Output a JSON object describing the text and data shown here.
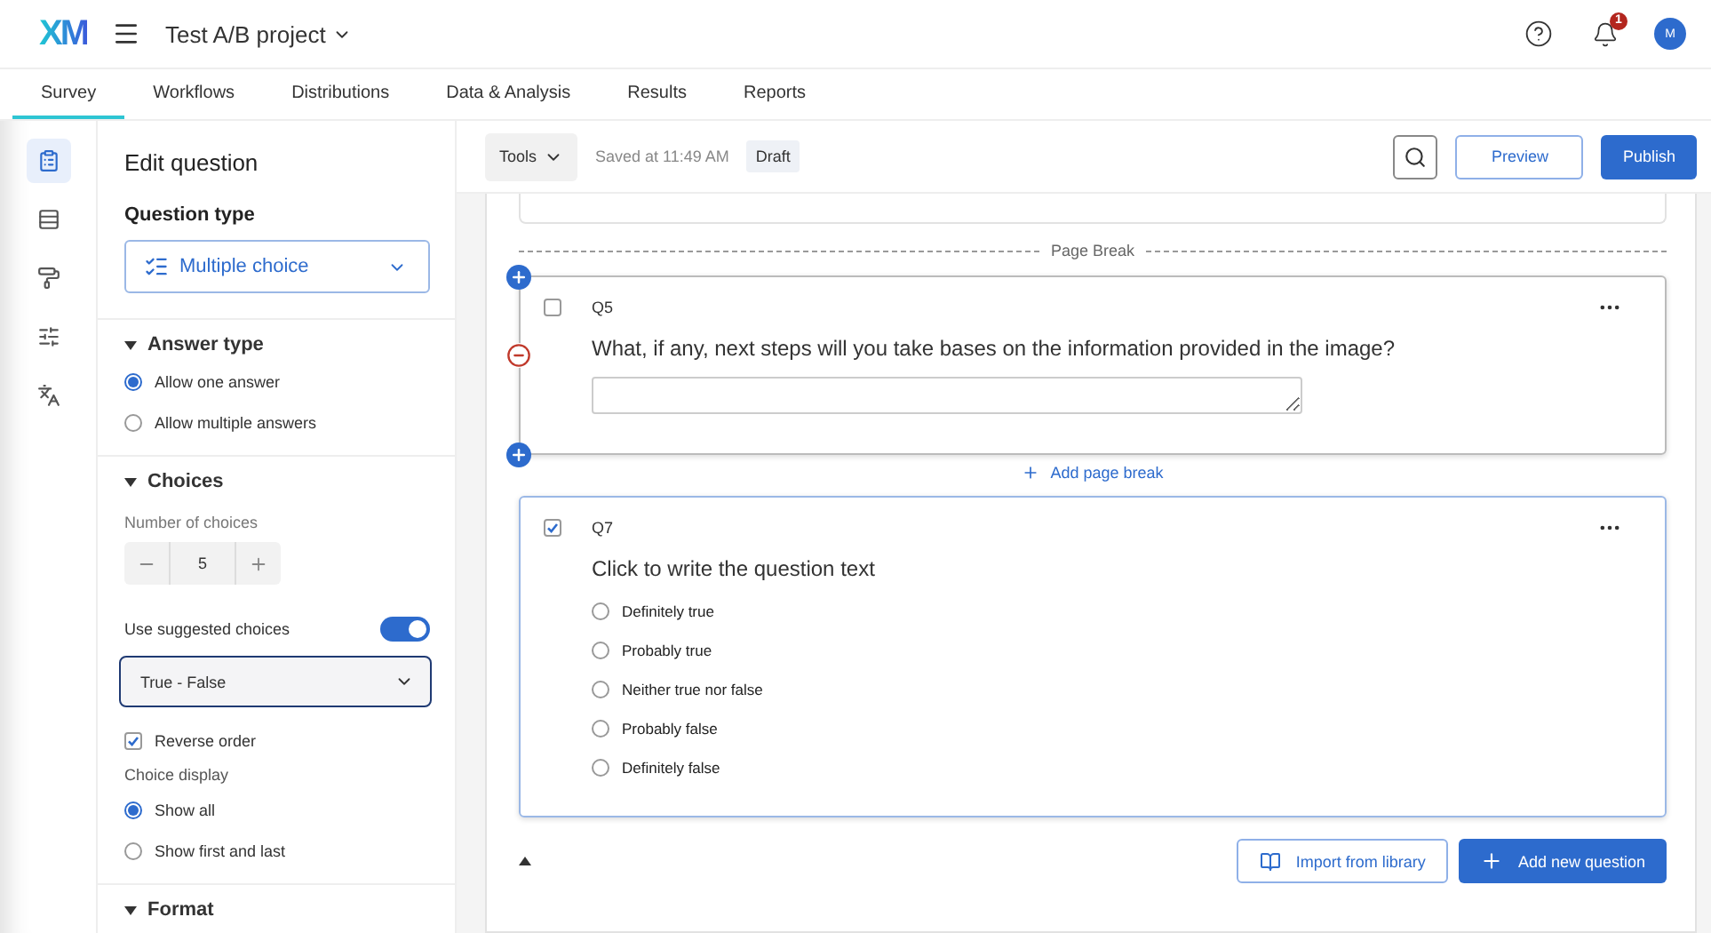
{
  "header": {
    "logo": "XM",
    "project": "Test A/B project",
    "notification_count": "1",
    "avatar": "M"
  },
  "nav_tabs": [
    {
      "label": "Survey",
      "selected": true
    },
    {
      "label": "Workflows",
      "selected": false
    },
    {
      "label": "Distributions",
      "selected": false
    },
    {
      "label": "Data & Analysis",
      "selected": false
    },
    {
      "label": "Results",
      "selected": false
    },
    {
      "label": "Reports",
      "selected": false
    }
  ],
  "rail": [
    {
      "kind": "clipboard",
      "selected": true
    },
    {
      "kind": "blocks",
      "selected": false
    },
    {
      "kind": "paint",
      "selected": false
    },
    {
      "kind": "sliders",
      "selected": false
    },
    {
      "kind": "translate",
      "selected": false
    }
  ],
  "edit_panel": {
    "title": "Edit question",
    "question_type_label": "Question type",
    "question_type_value": "Multiple choice",
    "answer_type": {
      "title": "Answer type",
      "expanded": true,
      "options": [
        {
          "label": "Allow one answer",
          "selected": true
        },
        {
          "label": "Allow multiple answers",
          "selected": false
        }
      ]
    },
    "choices": {
      "title": "Choices",
      "expanded": true,
      "number_label": "Number of choices",
      "count": "5",
      "suggested_label": "Use suggested choices",
      "suggested_on": true,
      "suggested_value": "True - False",
      "reverse_label": "Reverse order",
      "reverse_checked": true,
      "display_label": "Choice display",
      "display_options": [
        {
          "label": "Show all",
          "selected": true
        },
        {
          "label": "Show first and last",
          "selected": false
        }
      ]
    },
    "format": {
      "title": "Format",
      "expanded": true
    }
  },
  "toolbar": {
    "tools": "Tools",
    "saved": "Saved at 11:49 AM",
    "status": "Draft",
    "preview": "Preview",
    "publish": "Publish"
  },
  "page_break": "Page Break",
  "questions": [
    {
      "id": "Q5",
      "kind": "text_entry",
      "checked": false,
      "selected": false,
      "hovered": true,
      "text": "What, if any, next steps will you take bases on the information provided in the image?"
    },
    {
      "id": "Q7",
      "kind": "multiple_choice",
      "checked": true,
      "selected": true,
      "hovered": false,
      "text": "Click to write the question text",
      "choices": [
        "Definitely true",
        "Probably true",
        "Neither true nor false",
        "Probably false",
        "Definitely false"
      ]
    }
  ],
  "add_page_break": "Add page break",
  "import_button": "Import from library",
  "add_button": "Add new question"
}
